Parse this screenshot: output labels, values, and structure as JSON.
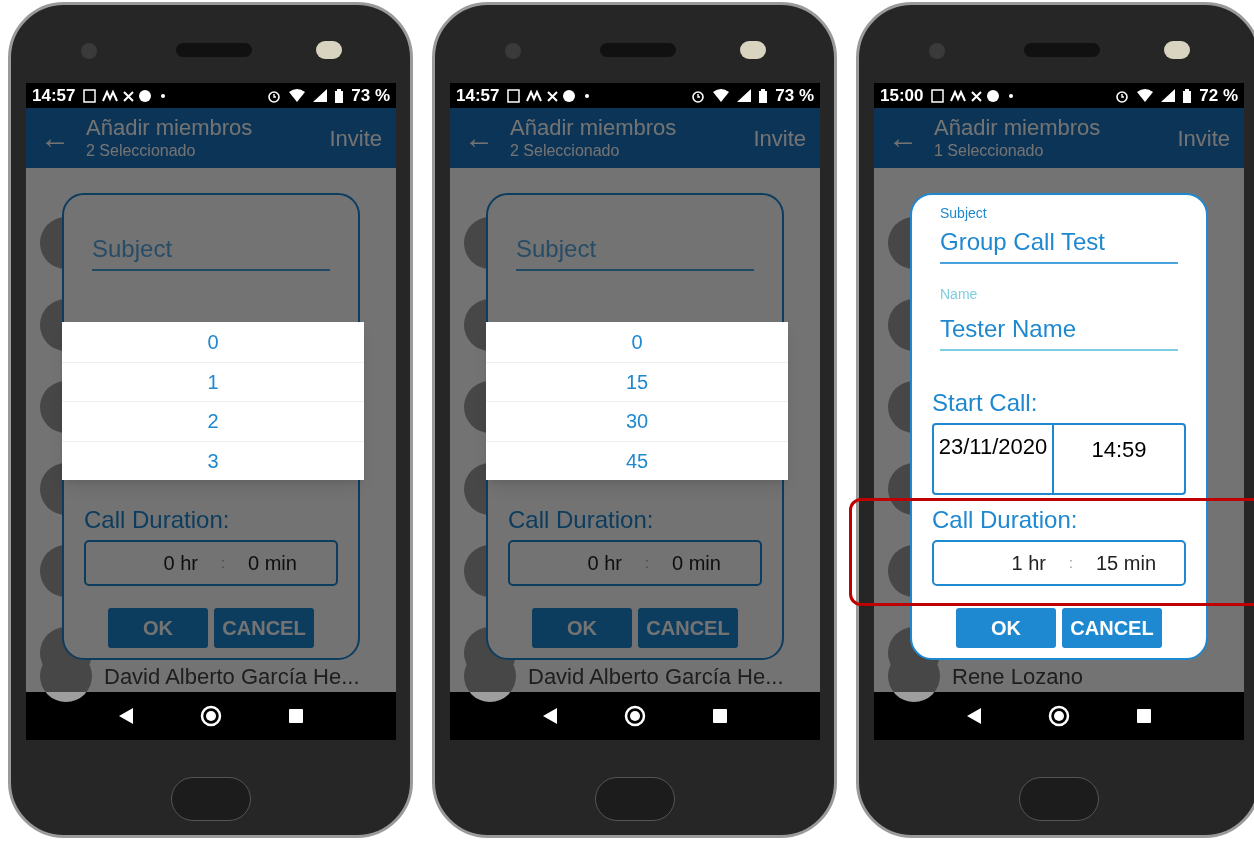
{
  "phones": [
    {
      "status_bar": {
        "time": "14:57",
        "battery": "73 %"
      },
      "app_bar": {
        "back": "←",
        "title": "Añadir miembros",
        "subtitle": "2 Seleccionado",
        "action": "Invite"
      },
      "contact": "David Alberto García He...",
      "dialog": {
        "dimmed": true,
        "subject": {
          "placeholder": "Subject"
        },
        "duration_label": "Call Duration:",
        "hours": "0 hr",
        "separator": ":",
        "minutes": "0 min",
        "buttons": [
          "OK",
          "CANCEL"
        ]
      },
      "picker": [
        "0",
        "1",
        "2",
        "3"
      ],
      "highlighted": false
    },
    {
      "status_bar": {
        "time": "14:57",
        "battery": "73 %"
      },
      "app_bar": {
        "back": "←",
        "title": "Añadir miembros",
        "subtitle": "2 Seleccionado",
        "action": "Invite"
      },
      "contact": "David Alberto García He...",
      "dialog": {
        "dimmed": true,
        "subject": {
          "placeholder": "Subject"
        },
        "duration_label": "Call Duration:",
        "hours": "0 hr",
        "separator": ":",
        "minutes": "0 min",
        "buttons": [
          "OK",
          "CANCEL"
        ]
      },
      "picker": [
        "0",
        "15",
        "30",
        "45"
      ],
      "highlighted": false
    },
    {
      "status_bar": {
        "time": "15:00",
        "battery": "72 %"
      },
      "app_bar": {
        "back": "←",
        "title": "Añadir miembros",
        "subtitle": "1 Seleccionado",
        "action": "Invite"
      },
      "contact": "Rene Lozano",
      "dialog": {
        "dimmed": false,
        "subject": {
          "label": "Subject",
          "value": "Group Call Test"
        },
        "name": {
          "label": "Name",
          "value": "Tester Name"
        },
        "start_label": "Start Call:",
        "start_date": "23/11/2020",
        "start_time": "14:59",
        "duration_label": "Call Duration:",
        "hours": "1 hr",
        "separator": ":",
        "minutes": "15 min",
        "buttons": [
          "OK",
          "CANCEL"
        ]
      },
      "highlighted": true
    }
  ]
}
